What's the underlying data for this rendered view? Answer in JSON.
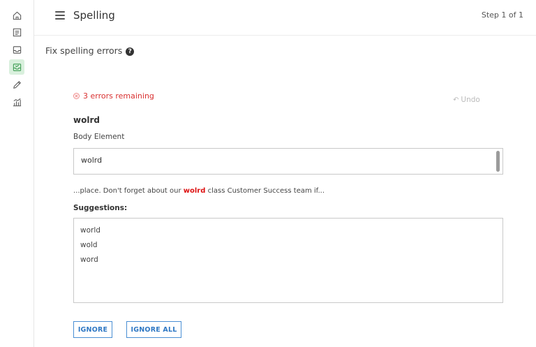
{
  "header": {
    "title": "Spelling",
    "step": "Step 1 of 1"
  },
  "page": {
    "heading": "Fix spelling errors"
  },
  "status": {
    "errors_remaining": "3 errors remaining",
    "undo_label": "Undo"
  },
  "current": {
    "word": "wolrd",
    "element_label": "Body Element",
    "input_value": "wolrd",
    "context_before": "...place. Don't forget about our ",
    "context_word": "wolrd",
    "context_after": " class Customer Success team if..."
  },
  "suggestions": {
    "label": "Suggestions:",
    "items": [
      "world",
      "wold",
      "word"
    ]
  },
  "buttons": {
    "ignore": "IGNORE",
    "ignore_all": "IGNORE ALL"
  },
  "sidebar": {
    "icons": [
      "home-icon",
      "document-icon",
      "inbox-icon",
      "inbox-check-icon",
      "pencil-icon",
      "chart-icon"
    ],
    "active_index": 3
  },
  "colors": {
    "error": "#d93030",
    "button": "#2f78c4",
    "active_bg": "#d9f0dd"
  }
}
